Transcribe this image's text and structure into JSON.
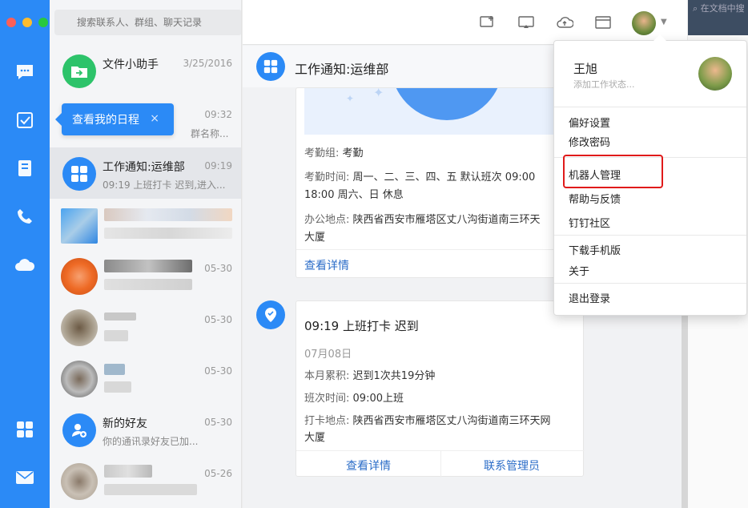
{
  "colors": {
    "accent": "#2b8af6",
    "highlight": "#e01a1a"
  },
  "search": {
    "placeholder": "搜索联系人、群组、聊天记录"
  },
  "tooltip": {
    "label": "查看我的日程",
    "close": "×"
  },
  "conversations": [
    {
      "title": "文件小助手",
      "time": "3/25/2016",
      "subtitle": ""
    },
    {
      "title": "",
      "time": "09:32",
      "subtitle": "群名称..."
    },
    {
      "title": "工作通知:运维部",
      "time": "09:19",
      "subtitle": "09:19 上班打卡 迟到,进入..."
    },
    {
      "title": "",
      "time": "",
      "subtitle": ""
    },
    {
      "title": "",
      "time": "05-30",
      "subtitle": ""
    },
    {
      "title": "",
      "time": "05-30",
      "subtitle": ""
    },
    {
      "title": "",
      "time": "05-30",
      "subtitle": ""
    },
    {
      "title": "新的好友",
      "time": "05-30",
      "subtitle": "你的通讯录好友已加..."
    },
    {
      "title": "",
      "time": "05-26",
      "subtitle": ""
    }
  ],
  "chat": {
    "title": "工作通知:运维部",
    "card1": {
      "group_key": "考勤组:",
      "group_val": "考勤",
      "time_key": "考勤时间:",
      "time_val1": "周一、二、三、四、五 默认班次 09:00",
      "time_val2": "18:00 周六、日 休息",
      "place_key": "办公地点:",
      "place_val1": "陕西省西安市雁塔区丈八沟街道南三环天",
      "place_val2": "大厦",
      "link": "查看详情"
    },
    "card2": {
      "title": "09:19 上班打卡 迟到",
      "date": "07月08日",
      "month_key": "本月累积:",
      "month_val": "迟到1次共19分钟",
      "shift_key": "班次时间:",
      "shift_val": "09:00上班",
      "place_key": "打卡地点:",
      "place_val1": "陕西省西安市雁塔区丈八沟街道南三环天网",
      "place_val2": "大厦",
      "link_details": "查看详情",
      "link_admin": "联系管理员"
    }
  },
  "right_strip": {
    "search_hint": "在文档中搜"
  },
  "menu": {
    "name": "王旭",
    "status": "添加工作状态...",
    "items": [
      "偏好设置",
      "修改密码",
      "机器人管理",
      "帮助与反馈",
      "钉钉社区",
      "下载手机版",
      "关于",
      "退出登录"
    ]
  }
}
